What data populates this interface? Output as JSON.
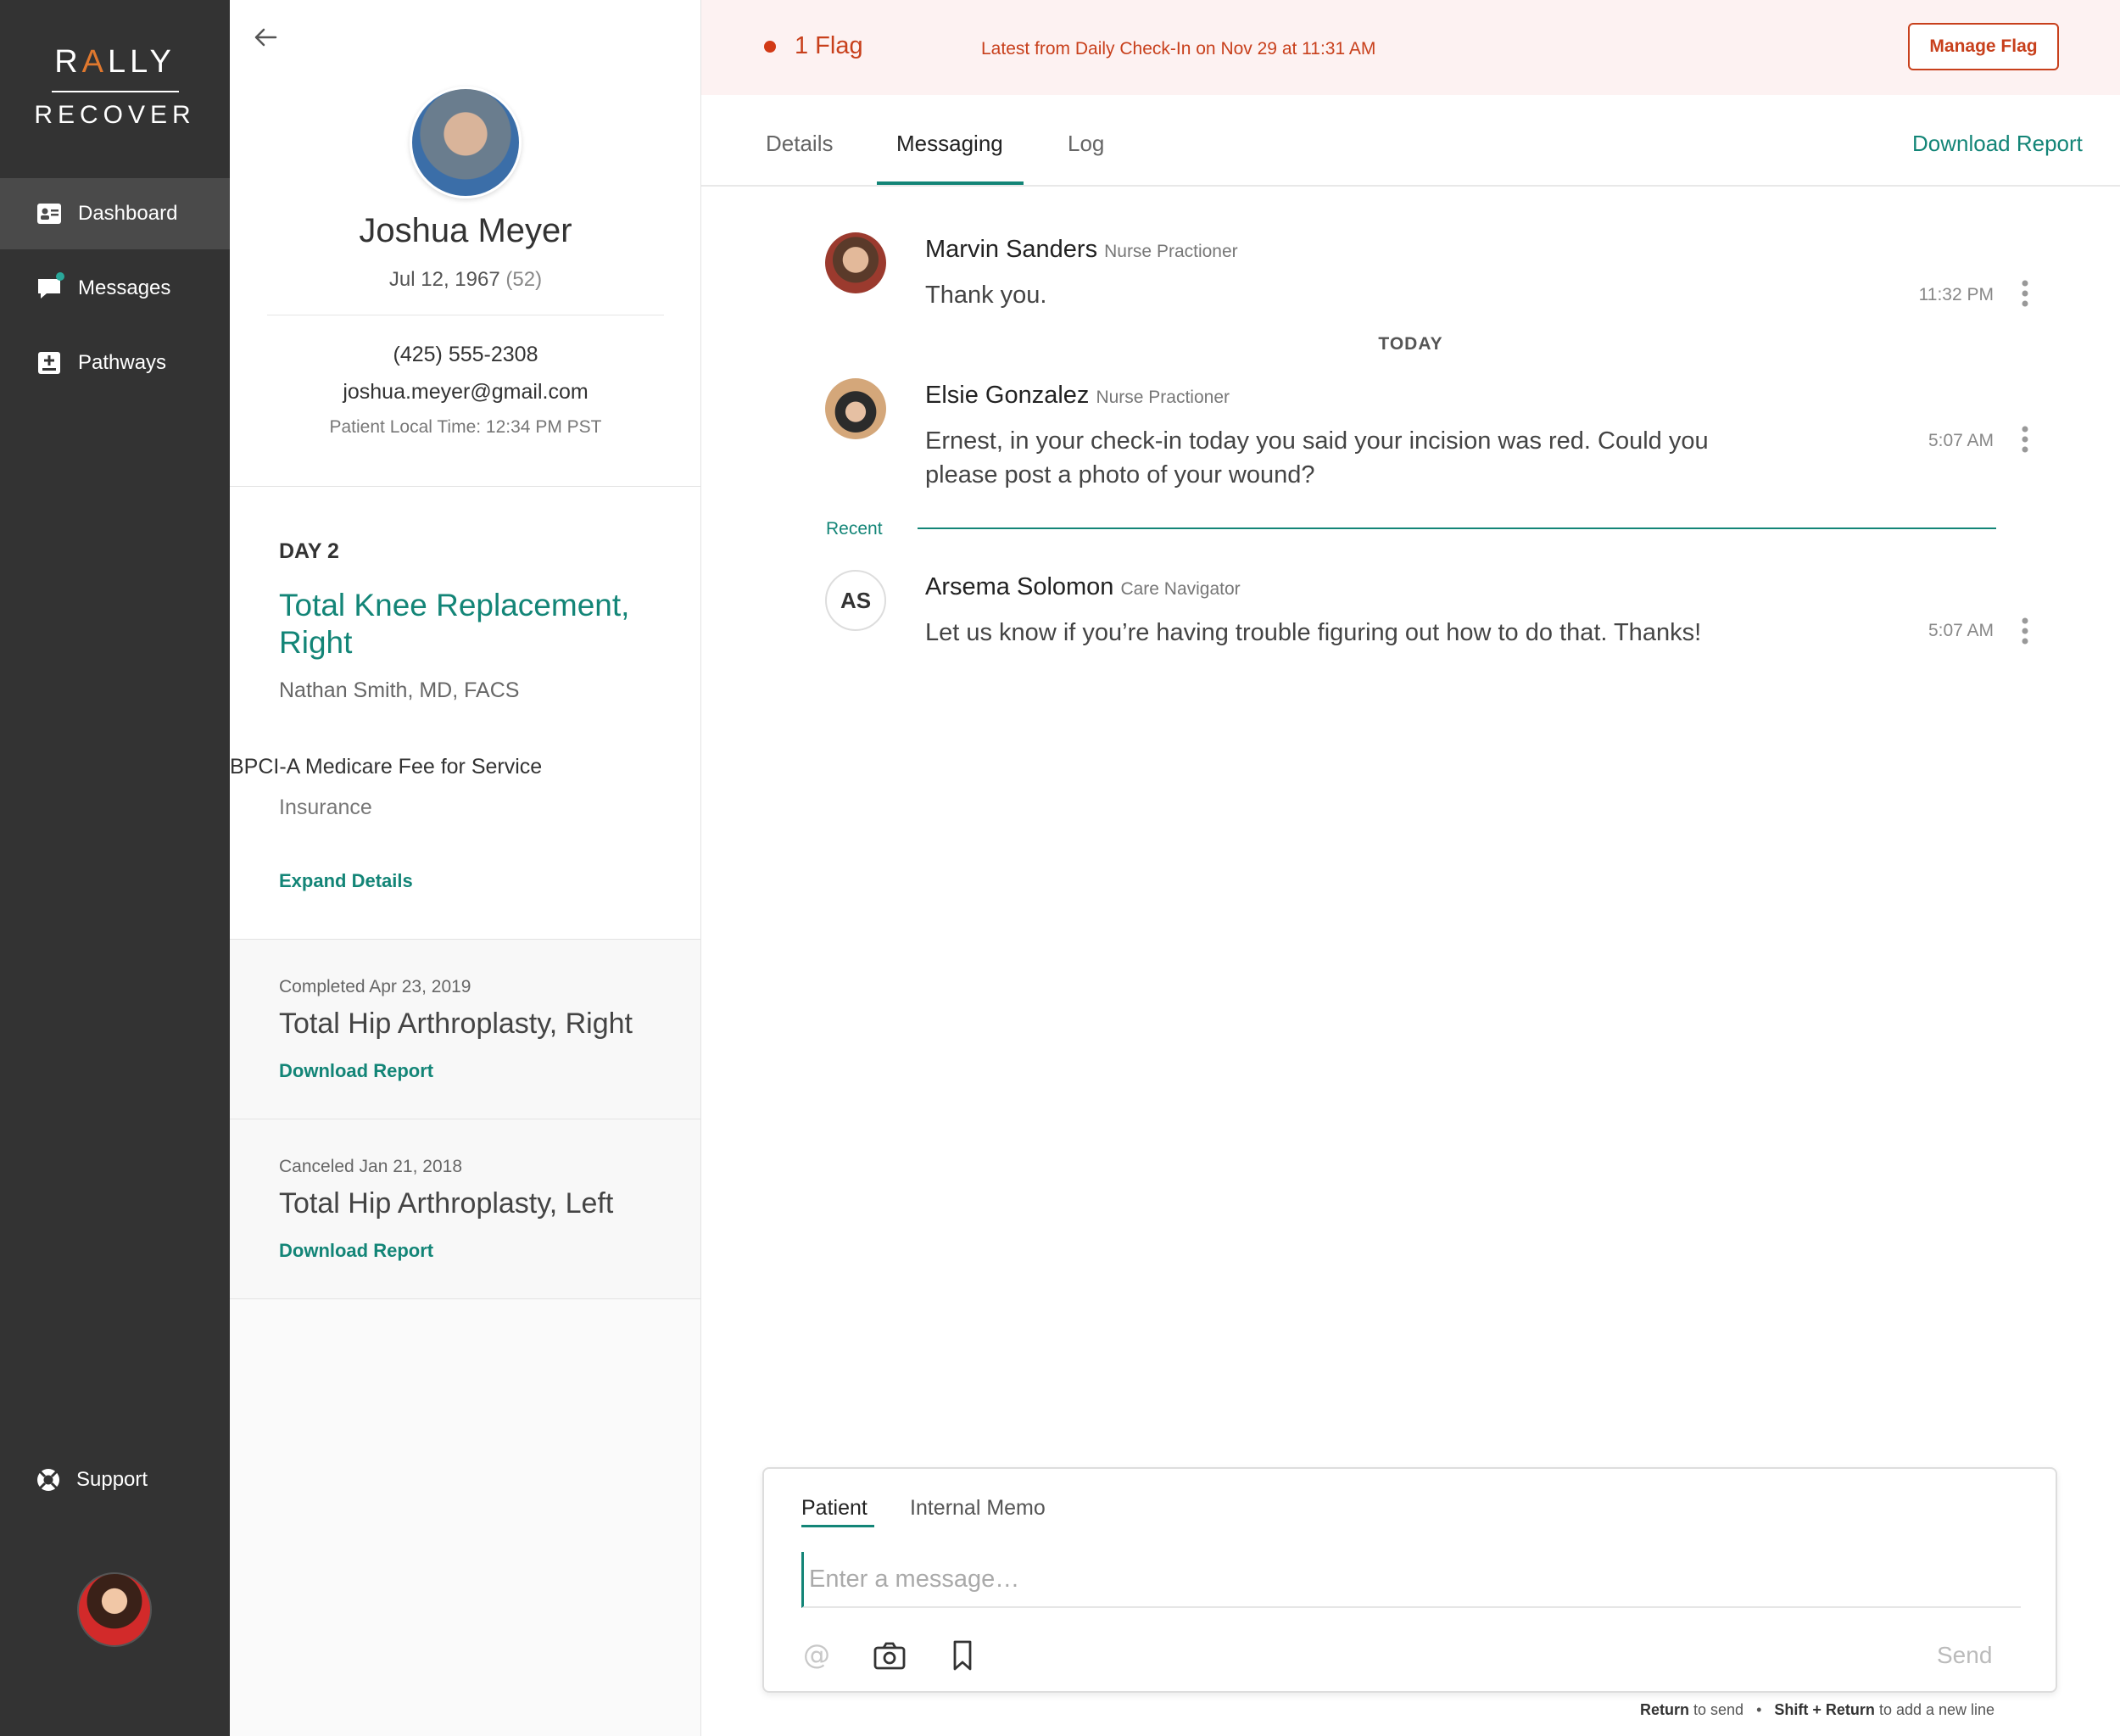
{
  "sidebar": {
    "logo_top": "RALLY",
    "logo_bottom": "RECOVER",
    "items": [
      {
        "label": "Dashboard",
        "icon": "dashboard-icon",
        "active": true
      },
      {
        "label": "Messages",
        "icon": "messages-icon",
        "active": false
      },
      {
        "label": "Pathways",
        "icon": "pathways-icon",
        "active": false
      }
    ],
    "support_label": "Support"
  },
  "patient": {
    "name": "Joshua Meyer",
    "dob": "Jul 12, 1967",
    "age": "(52)",
    "phone": "(425) 555-2308",
    "email": "joshua.meyer@gmail.com",
    "local_time": "Patient Local Time: 12:34 PM PST"
  },
  "episode": {
    "day": "DAY 2",
    "title": "Total Knee Replacement, Right",
    "doctor": "Nathan Smith, MD, FACS",
    "plan": "BPCI-A Medicare Fee for Service",
    "plan_label": "Insurance",
    "expand_label": "Expand Details"
  },
  "history": [
    {
      "date": "Completed Apr 23, 2019",
      "title": "Total Hip Arthroplasty, Right",
      "link": "Download Report"
    },
    {
      "date": "Canceled Jan 21, 2018",
      "title": "Total Hip Arthroplasty, Left",
      "link": "Download Report"
    }
  ],
  "flag": {
    "count": "1 Flag",
    "latest": "Latest from Daily Check-In on Nov 29 at 11:31 AM",
    "button": "Manage Flag"
  },
  "tabs": {
    "items": [
      "Details",
      "Messaging",
      "Log"
    ],
    "active": "Messaging",
    "download": "Download Report"
  },
  "messages": [
    {
      "name": "Marvin Sanders",
      "role": "Nurse Practioner",
      "body": "Thank you.",
      "time": "11:32 PM"
    },
    {
      "name": "Elsie Gonzalez",
      "role": "Nurse Practioner",
      "body": "Ernest, in your check-in today you said your incision was red. Could you please post a photo of your wound?",
      "time": "5:07 AM"
    },
    {
      "name": "Arsema Solomon",
      "role": "Care Navigator",
      "initials": "AS",
      "body": "Let us know if you’re having trouble figuring out how to do that. Thanks!",
      "time": "5:07 AM"
    }
  ],
  "divider_today": "TODAY",
  "divider_recent": "Recent",
  "composer": {
    "tab_patient": "Patient",
    "tab_memo": "Internal Memo",
    "placeholder": "Enter a message…",
    "send": "Send",
    "hint_return": "Return",
    "hint_return_text": "to send",
    "hint_sep": "•",
    "hint_shift": "Shift + Return",
    "hint_shift_text": "to add a new line"
  },
  "colors": {
    "accent": "#138577",
    "flag": "#c8401c",
    "sidebar": "#333333"
  }
}
